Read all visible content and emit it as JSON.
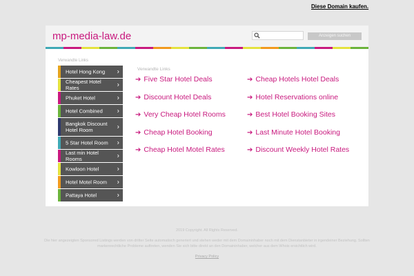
{
  "top_link": "Diese Domain kaufen.",
  "header": {
    "site_title": "mp-media-law.de",
    "search_placeholder": "",
    "search_button": "Anzeigen suchen"
  },
  "stripe_colors": [
    "#3fa9b5",
    "#c8197e",
    "#e4e23e",
    "#6bb33b",
    "#3fa9b5",
    "#c8197e",
    "#f19a1d",
    "#e4e23e",
    "#6bb33b",
    "#3fa9b5",
    "#c8197e",
    "#e4e23e",
    "#f19a1d",
    "#6bb33b",
    "#3fa9b5",
    "#c8197e",
    "#e4e23e",
    "#6bb33b"
  ],
  "sidebar": {
    "heading": "Verwandte Links",
    "items": [
      {
        "label": "Hotel Hong Kong",
        "color": "#e4a31d"
      },
      {
        "label": "Cheapest Hotel Rates",
        "color": "#e4e23e"
      },
      {
        "label": "Phuket Hotel",
        "color": "#c8197e"
      },
      {
        "label": "Hotel Combined",
        "color": "#6bb33b"
      },
      {
        "label": "Bangkok Discount Hotel Room",
        "color": "#2e3a6e"
      },
      {
        "label": "5 Star Hotel Room",
        "color": "#3fa9b5"
      },
      {
        "label": "Last min Hotel Rooms",
        "color": "#c8197e"
      },
      {
        "label": "Kowloon Hotel",
        "color": "#e4e23e"
      },
      {
        "label": "Hotel Motel Room",
        "color": "#f19a1d"
      },
      {
        "label": "Pattaya Hotel",
        "color": "#6bb33b"
      }
    ],
    "chevron_icon": "chevron-right-icon"
  },
  "main": {
    "heading": "Verwandte Links",
    "links_left": [
      "Five Star Hotel Deals",
      "Discount Hotel Deals",
      "Very Cheap Hotel Rooms",
      "Cheap Hotel Booking",
      "Cheap Hotel Motel Rates"
    ],
    "links_right": [
      "Cheap Hotels Hotel Deals",
      "Hotel Reservations online",
      "Best Hotel Booking Sites",
      "Last Minute Hotel Booking",
      "Discount Weekly Hotel Rates"
    ],
    "arrow_glyph": "➔"
  },
  "footer": {
    "copyright": "2019 Copyright. All Rights Reserved.",
    "disclaimer": "Die hier angezeigten Sponsored Listings werden von dritter Seite automatisch generiert und stehen weder mit dem Domaininhaber noch mit dem Dienstanbieter in irgendeiner Beziehung. Sollten markenrechtliche Probleme auftreten, wenden Sie sich bitte direkt an den Domaininhaber, welcher aus dem Whois ersichtlich wird.",
    "privacy": "Privacy Policy"
  }
}
